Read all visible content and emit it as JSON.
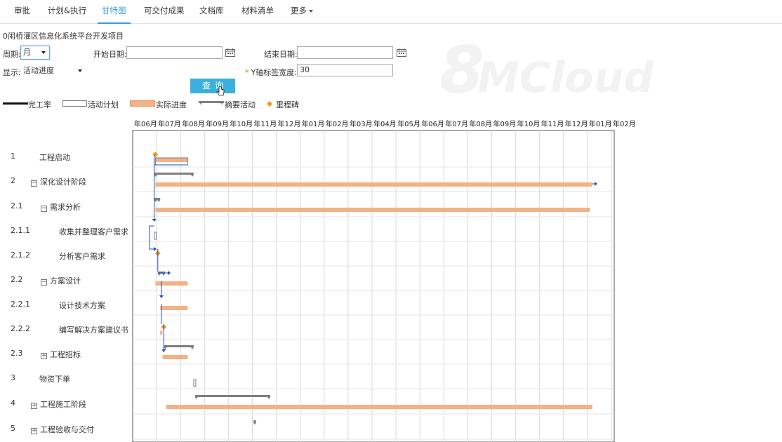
{
  "nav": {
    "tabs": [
      {
        "label": "审批"
      },
      {
        "label": "计划&执行"
      },
      {
        "label": "甘特图"
      },
      {
        "label": "可交付成果"
      },
      {
        "label": "文档库"
      },
      {
        "label": "材料清单"
      },
      {
        "label": "更多"
      }
    ],
    "active_tab": "甘特图"
  },
  "watermark": {
    "big": "8",
    "rest": "MCloud"
  },
  "project_title": "0闹桥灌区信息化系统平台开发项目",
  "filters": {
    "period_label": "周期:",
    "period_value": "月",
    "start_date_label": "开始日期:",
    "start_date_value": "",
    "end_date_label": "结束日期:",
    "end_date_value": "",
    "display_label": "显示:",
    "display_value": "活动进度",
    "y_label_width_label": "Y轴标签宽度:",
    "y_label_width_value": "30",
    "query_label": "查询"
  },
  "legend": [
    {
      "label": "完工率"
    },
    {
      "label": "活动计划"
    },
    {
      "label": "实际进度"
    },
    {
      "label": "摘要活动"
    },
    {
      "label": "里程碑"
    }
  ],
  "colors": {
    "accent": "#3a9bd6",
    "button": "#3bb0df",
    "actual_progress": "#f4b183",
    "summary": "#7f7f7f",
    "milestone": "#f29b1d",
    "dependency": "#1f4fbf"
  },
  "gantt": {
    "months": [
      "年06月",
      "年07月",
      "年08月",
      "年09月",
      "年10月",
      "年11月",
      "年12月",
      "年01月",
      "年02月",
      "年03月",
      "年04月",
      "年05月",
      "年06月",
      "年07月",
      "年08月",
      "年09月",
      "年10月",
      "年11月",
      "年12月",
      "年01月",
      "年02月"
    ],
    "rows": [
      {
        "id": "1",
        "name": "工程启动",
        "toggle": ""
      },
      {
        "id": "2",
        "name": "深化设计阶段",
        "toggle": "⊟"
      },
      {
        "id": "2.1",
        "name": "需求分析",
        "toggle": "⊟"
      },
      {
        "id": "2.1.1",
        "name": "收集并整理客户需求",
        "toggle": ""
      },
      {
        "id": "2.1.2",
        "name": "分析客户需求",
        "toggle": ""
      },
      {
        "id": "2.2",
        "name": "方案设计",
        "toggle": "⊟"
      },
      {
        "id": "2.2.1",
        "name": "设计技术方案",
        "toggle": ""
      },
      {
        "id": "2.2.2",
        "name": "编写解决方案建议书",
        "toggle": ""
      },
      {
        "id": "2.3",
        "name": "工程招标",
        "toggle": "⊞"
      },
      {
        "id": "3",
        "name": "物资下单",
        "toggle": ""
      },
      {
        "id": "4",
        "name": "工程施工阶段",
        "toggle": "⊞"
      },
      {
        "id": "5",
        "name": "工程验收与交付",
        "toggle": "⊞"
      }
    ]
  },
  "chart_data": {
    "type": "gantt",
    "x_unit": "month",
    "x_ticks": [
      "年06月",
      "年07月",
      "年08月",
      "年09月",
      "年10月",
      "年11月",
      "年12月",
      "年01月",
      "年02月",
      "年03月",
      "年04月",
      "年05月",
      "年06月",
      "年07月",
      "年08月",
      "年09月",
      "年10月",
      "年11月",
      "年12月",
      "年01月",
      "年02月"
    ],
    "tasks": [
      {
        "row": "1",
        "milestone_month": 0.95,
        "plan": [
          0.95,
          2.3
        ],
        "actual": [
          0.95,
          2.3
        ]
      },
      {
        "row": "2",
        "summary": [
          0.9,
          2.55
        ],
        "actual": [
          0.95,
          19.2
        ]
      },
      {
        "row": "2.1",
        "summary": [
          0.9,
          1.15
        ],
        "actual": [
          0.95,
          19.1
        ]
      },
      {
        "row": "2.1.1",
        "plan": [
          0.9,
          0.98
        ]
      },
      {
        "row": "2.1.2",
        "milestone_month": 1.05
      },
      {
        "row": "2.2",
        "summary": [
          1.05,
          1.35
        ],
        "actual": [
          0.95,
          2.3
        ]
      },
      {
        "row": "2.2.1",
        "actual": [
          1.15,
          2.3
        ]
      },
      {
        "row": "2.2.2",
        "milestone_month": 1.3,
        "actual": [
          1.15,
          1.2
        ]
      },
      {
        "row": "2.3",
        "summary": [
          1.3,
          2.55
        ],
        "actual": [
          1.25,
          2.3
        ]
      },
      {
        "row": "3",
        "plan": [
          2.55,
          2.62
        ]
      },
      {
        "row": "4",
        "summary": [
          2.6,
          5.75
        ],
        "actual": [
          1.4,
          19.2
        ]
      },
      {
        "row": "5",
        "summary": [
          5.05,
          5.15
        ]
      }
    ]
  }
}
